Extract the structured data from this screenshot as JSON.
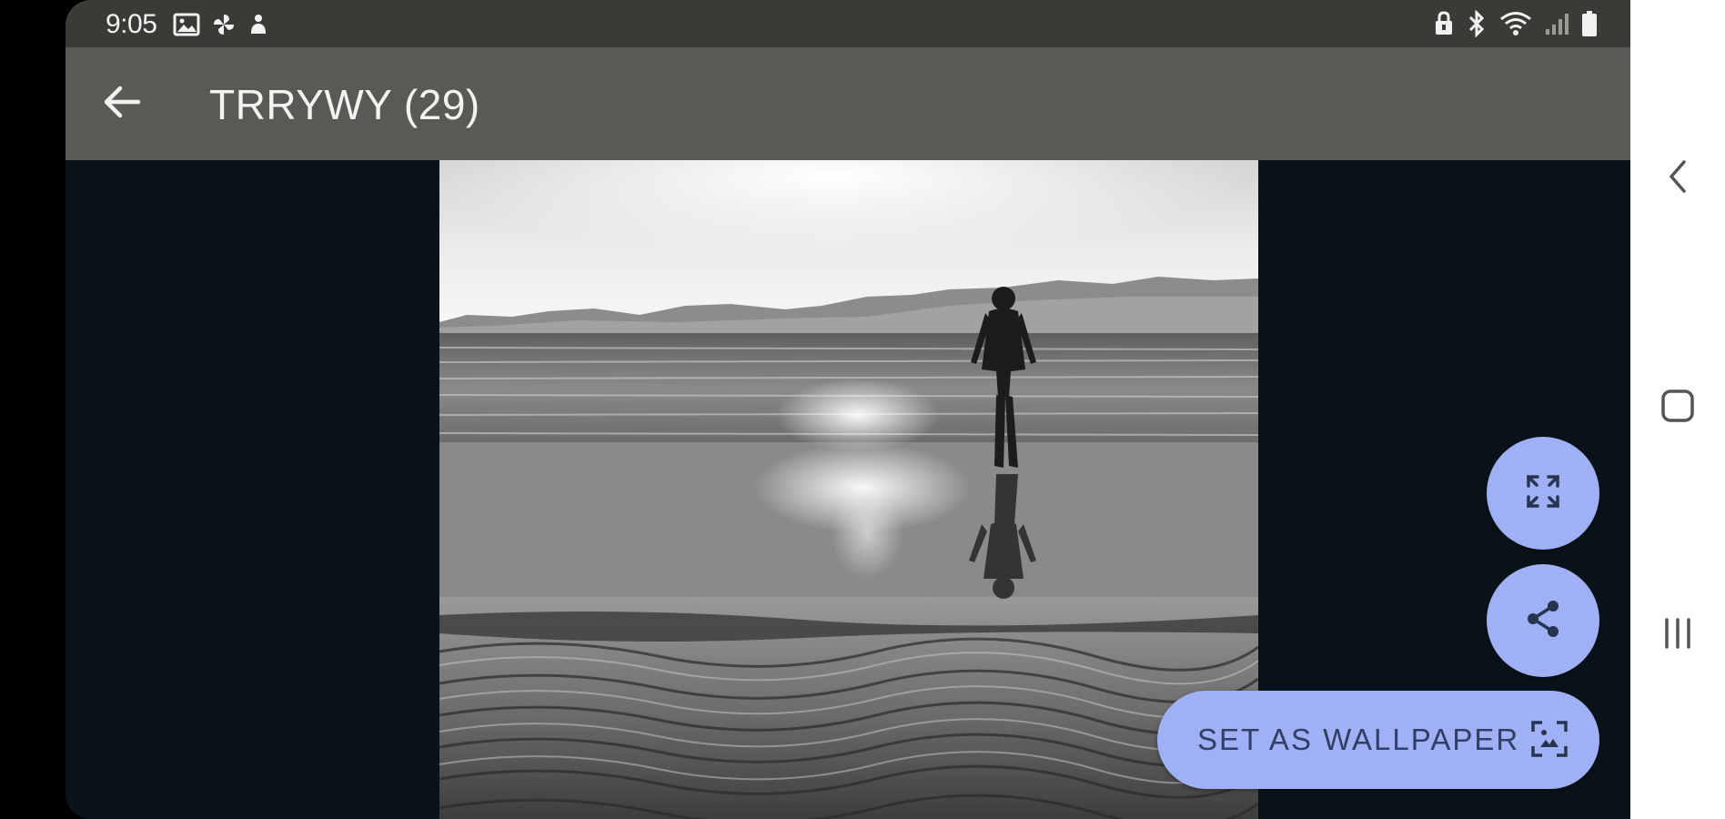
{
  "status_bar": {
    "time": "9:05",
    "left_icons": [
      "gallery-icon",
      "pinwheel-icon",
      "notification-icon"
    ],
    "right_icons": [
      "secure-lock-icon",
      "bluetooth-icon",
      "wifi-icon",
      "signal-icon",
      "battery-icon"
    ]
  },
  "app_bar": {
    "title": "TRRYWY (29)",
    "back_icon": "arrow-back-icon"
  },
  "actions": {
    "fullscreen_icon": "fullscreen-icon",
    "share_icon": "share-icon",
    "set_wallpaper_label": "SET AS WALLPAPER",
    "set_wallpaper_icon": "wallpaper-frame-icon"
  },
  "navigation_bar": {
    "buttons": [
      "back-icon",
      "home-icon",
      "recents-icon"
    ]
  },
  "colors": {
    "status_bar": "#3a3a36",
    "app_bar": "#5a5a55",
    "background": "#08131a",
    "fab": "#9fb0f5",
    "fab_text": "#2f3f66"
  }
}
